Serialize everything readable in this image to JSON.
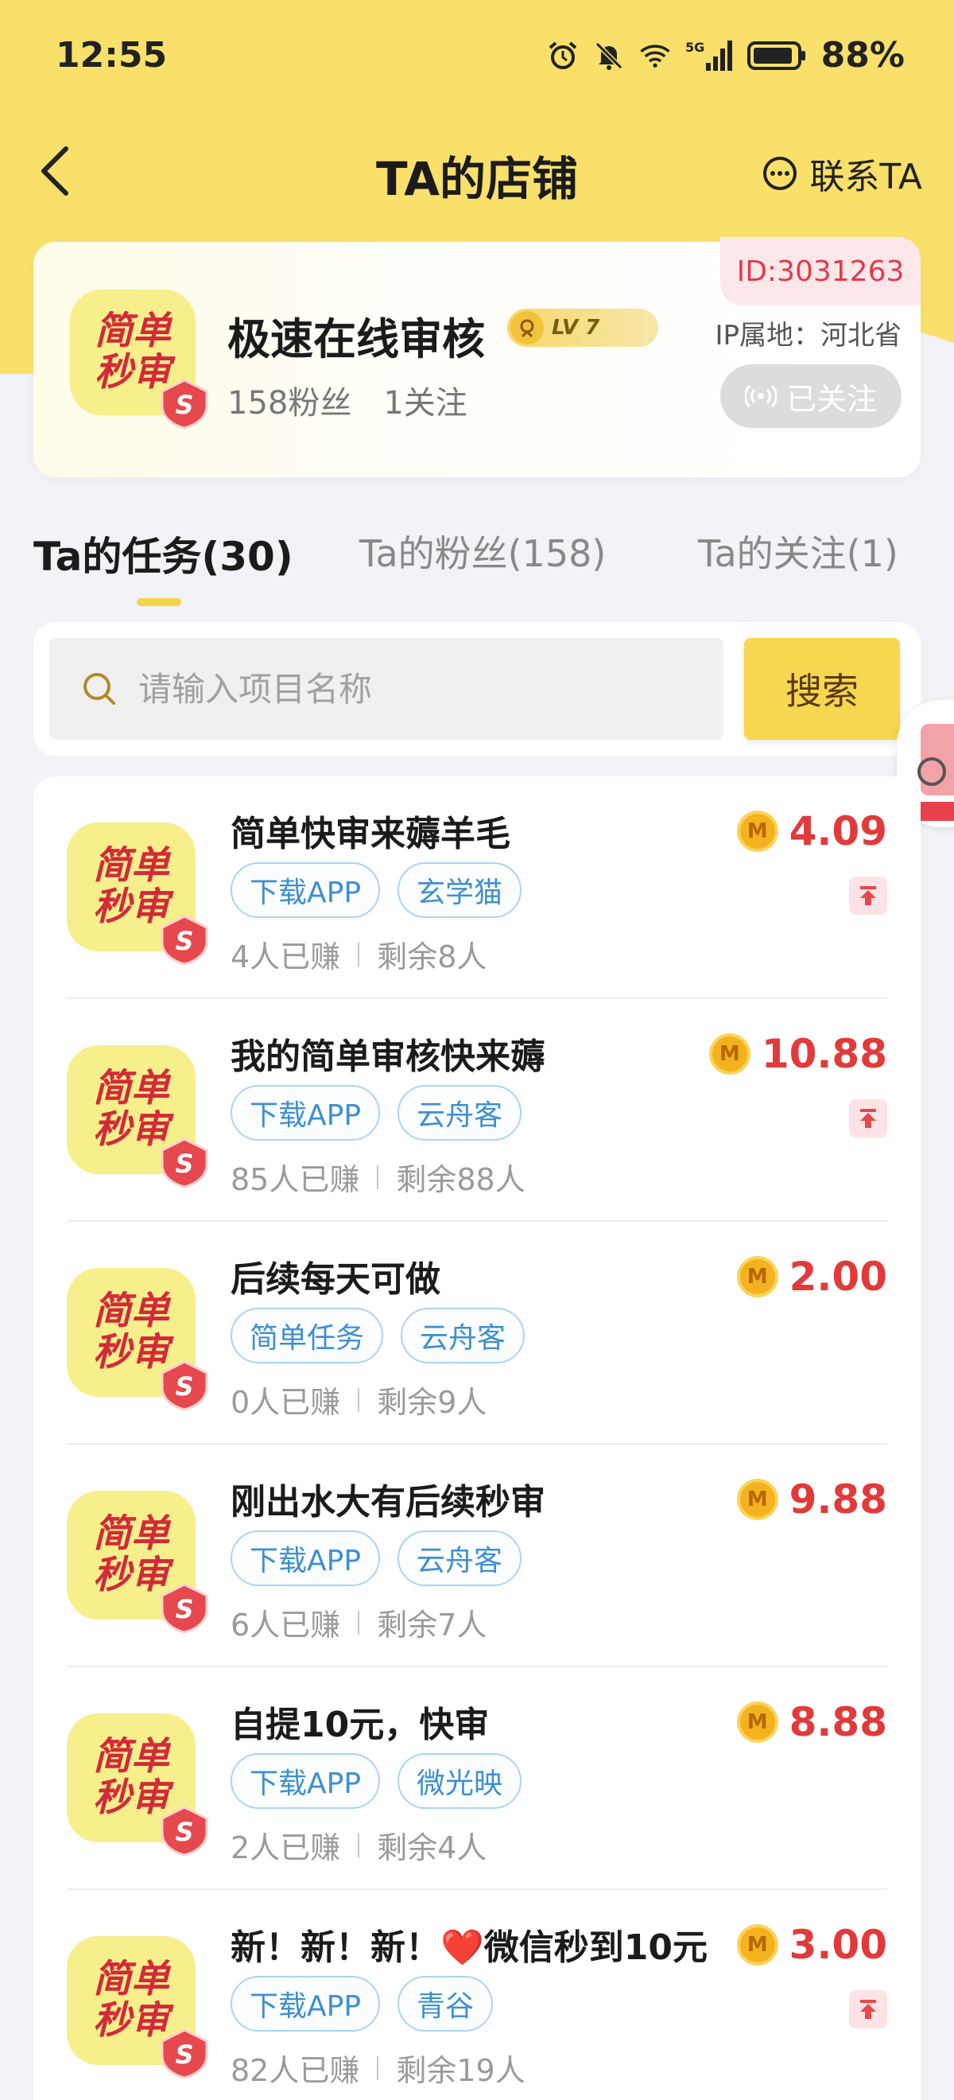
{
  "status_bar": {
    "time": "12:55",
    "battery": "88%",
    "network": "5G"
  },
  "header": {
    "title": "TA的店铺",
    "contact_label": "联系TA"
  },
  "shop": {
    "logo_line1": "简单",
    "logo_line2": "秒审",
    "name": "极速在线审核",
    "level": "LV 7",
    "fans": "158粉丝",
    "following": "1关注",
    "id": "ID:3031263",
    "ip": "IP属地：河北省",
    "follow_label": "已关注"
  },
  "tabs": [
    {
      "label": "Ta的任务(30)",
      "active": true
    },
    {
      "label": "Ta的粉丝(158)",
      "active": false
    },
    {
      "label": "Ta的关注(1)",
      "active": false
    }
  ],
  "search": {
    "placeholder": "请输入项目名称",
    "button_label": "搜索"
  },
  "tasks": [
    {
      "title": "简单快审来薅羊毛",
      "tags": [
        "下载APP",
        "玄学猫"
      ],
      "earned": "4人已赚",
      "remaining": "剩余8人",
      "price": "4.09",
      "pinned": true
    },
    {
      "title": "我的简单审核快来薅",
      "tags": [
        "下载APP",
        "云舟客"
      ],
      "earned": "85人已赚",
      "remaining": "剩余88人",
      "price": "10.88",
      "pinned": true
    },
    {
      "title": "后续每天可做",
      "tags": [
        "简单任务",
        "云舟客"
      ],
      "earned": "0人已赚",
      "remaining": "剩余9人",
      "price": "2.00",
      "pinned": false
    },
    {
      "title": "刚出水大有后续秒审",
      "tags": [
        "下载APP",
        "云舟客"
      ],
      "earned": "6人已赚",
      "remaining": "剩余7人",
      "price": "9.88",
      "pinned": false
    },
    {
      "title": "自提10元，快审",
      "tags": [
        "下载APP",
        "微光映"
      ],
      "earned": "2人已赚",
      "remaining": "剩余4人",
      "price": "8.88",
      "pinned": false
    },
    {
      "title": "新！新！新！❤️微信秒到10元",
      "tags": [
        "下载APP",
        "青谷"
      ],
      "earned": "82人已赚",
      "remaining": "剩余19人",
      "price": "3.00",
      "pinned": true
    }
  ],
  "coin_letter": "M",
  "colors": {
    "brand_yellow": "#f8e06a",
    "price_red": "#e23a3a",
    "tag_blue": "#3e8fd3"
  }
}
